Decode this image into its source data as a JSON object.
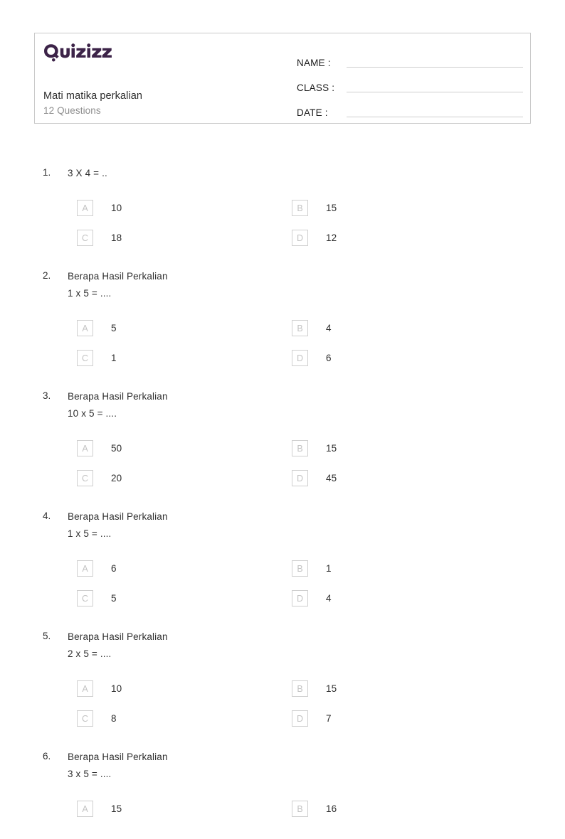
{
  "brand": {
    "name": "Quizizz",
    "logo_color": "#3c2348"
  },
  "header": {
    "title": "Mati matika perkalian",
    "question_count_label": "12 Questions",
    "fields": [
      {
        "label": "NAME :"
      },
      {
        "label": "CLASS :"
      },
      {
        "label": "DATE  :"
      }
    ]
  },
  "questions": [
    {
      "number": "1.",
      "text": "3 X 4 = ..",
      "options": [
        {
          "letter": "A",
          "text": "10"
        },
        {
          "letter": "B",
          "text": "15"
        },
        {
          "letter": "C",
          "text": "18"
        },
        {
          "letter": "D",
          "text": "12"
        }
      ]
    },
    {
      "number": "2.",
      "text": "Berapa Hasil Perkalian\n1 x 5 = ....",
      "options": [
        {
          "letter": "A",
          "text": "5"
        },
        {
          "letter": "B",
          "text": "4"
        },
        {
          "letter": "C",
          "text": "1"
        },
        {
          "letter": "D",
          "text": "6"
        }
      ]
    },
    {
      "number": "3.",
      "text": "Berapa Hasil Perkalian\n10 x 5 = ....",
      "options": [
        {
          "letter": "A",
          "text": "50"
        },
        {
          "letter": "B",
          "text": "15"
        },
        {
          "letter": "C",
          "text": "20"
        },
        {
          "letter": "D",
          "text": "45"
        }
      ]
    },
    {
      "number": "4.",
      "text": "Berapa Hasil Perkalian\n1 x 5 = ....",
      "options": [
        {
          "letter": "A",
          "text": "6"
        },
        {
          "letter": "B",
          "text": "1"
        },
        {
          "letter": "C",
          "text": "5"
        },
        {
          "letter": "D",
          "text": "4"
        }
      ]
    },
    {
      "number": "5.",
      "text": "Berapa Hasil Perkalian\n2 x 5 = ....",
      "options": [
        {
          "letter": "A",
          "text": "10"
        },
        {
          "letter": "B",
          "text": "15"
        },
        {
          "letter": "C",
          "text": "8"
        },
        {
          "letter": "D",
          "text": "7"
        }
      ]
    },
    {
      "number": "6.",
      "text": "Berapa Hasil Perkalian\n3 x 5 = ....",
      "options": [
        {
          "letter": "A",
          "text": "15"
        },
        {
          "letter": "B",
          "text": "16"
        }
      ]
    }
  ]
}
